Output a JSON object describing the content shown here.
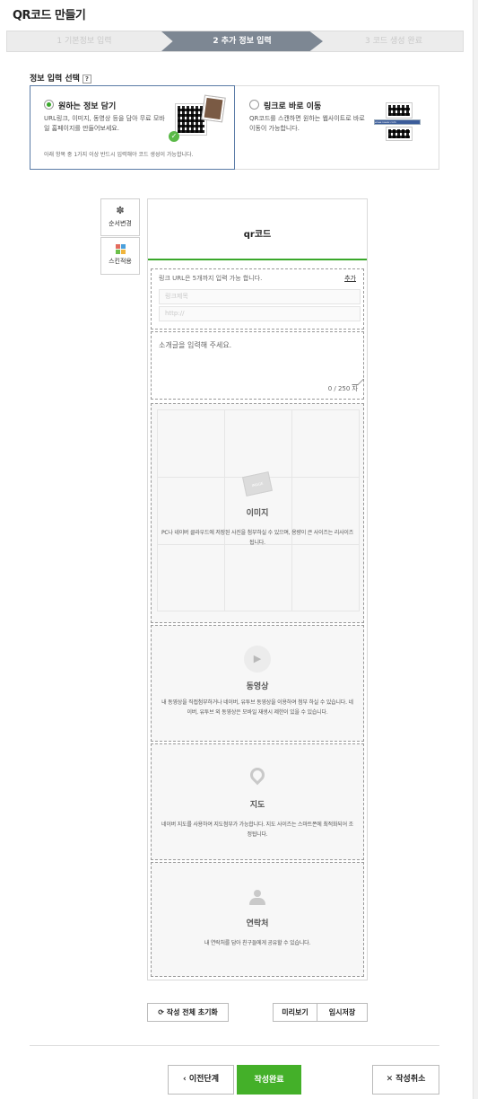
{
  "page": {
    "title": "QR코드 만들기"
  },
  "steps": [
    {
      "label": "1 기본정보 입력",
      "state": "done"
    },
    {
      "label": "2 추가 정보 입력",
      "state": "active"
    },
    {
      "label": "3 코드 생성 완료",
      "state": "todo"
    }
  ],
  "info_select": {
    "label": "정보 입력 선택",
    "help": "?",
    "options": [
      {
        "title": "원하는 정보 담기",
        "desc": "URL링크, 이미지, 동영상 등을 담아 무료 모바일 홈페이지를 만들어보세요.",
        "note": "아래 항목 중 1가지 이상 반드시 입력해야 코드 생성이 가능합니다.",
        "selected": true
      },
      {
        "title": "링크로 바로 이동",
        "desc": "QR코드를 스캔하면 원하는 웹사이트로 바로 이동이 가능합니다.",
        "url_thumb": "www.naver.com",
        "selected": false
      }
    ]
  },
  "tools": {
    "reorder": {
      "label": "순서변경",
      "icon": "gear-icon"
    },
    "skin": {
      "label": "스킨적용",
      "icon": "skin-grid-icon"
    }
  },
  "editor": {
    "title": "qr코드",
    "link": {
      "hint": "링크 URL은 5개까지 입력 가능 합니다.",
      "add_label": "추가",
      "title_placeholder": "링크제목",
      "url_placeholder": "http://"
    },
    "intro": {
      "placeholder": "소개글을 입력해 주세요.",
      "counter": "0 / 250 자"
    },
    "image": {
      "title": "이미지",
      "desc": "PC나 네이버 클라우드에 저장된 사진을 첨부하실 수 있으며, 용량이 큰 사이즈는 리사이즈 됩니다."
    },
    "video": {
      "title": "동영상",
      "desc": "내 동영상을 직접첨부하거나 네이버, 유투브 동영상을 이용하여 첨부 하실 수 있습니다. 네이버, 유투브 외 동영상은 모바일 재생시 제한이 있을 수 있습니다."
    },
    "map": {
      "title": "지도",
      "desc": "네이버 지도를 사용하여 지도첨부가 가능합니다. 지도 사이즈는 스마트폰에 최적화되어 조정됩니다."
    },
    "contact": {
      "title": "연락처",
      "desc": "내 연락처를 담아 친구들에게 공유할 수 있습니다."
    }
  },
  "actions": {
    "reset": "작성 전체 초기화",
    "preview": "미리보기",
    "temp_save": "임시저장",
    "prev": "이전단계",
    "done": "작성완료",
    "cancel": "작성취소"
  },
  "colors": {
    "accent_green": "#44b029",
    "step_active": "#7d8793",
    "selected_border": "#5a7ba6"
  }
}
